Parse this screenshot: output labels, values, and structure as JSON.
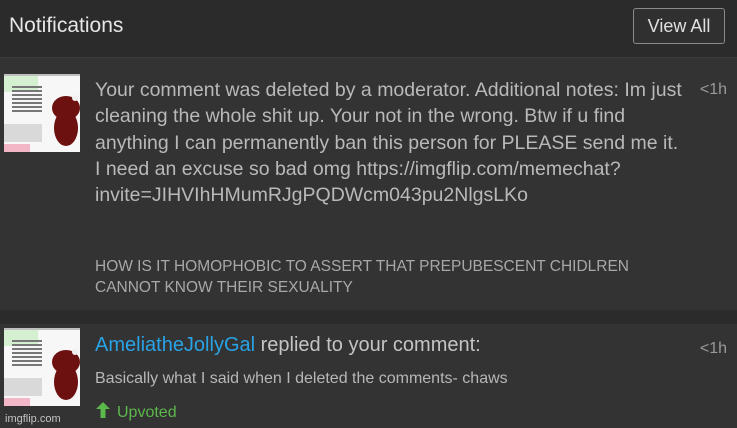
{
  "header": {
    "title": "Notifications",
    "view_all_label": "View All"
  },
  "notifications": [
    {
      "text": "Your comment was deleted by a moderator. Additional notes: Im just cleaning the whole shit up. Your not in the wrong. Btw if u find anything I can permanently ban this person for PLEASE send me it. I need an excuse so bad omg https://imgflip.com/memechat?invite=JIHVIhHMumRJgPQDWcm043pu2NlgsLKo",
      "quoted": "HOW IS IT HOMOPHOBIC TO ASSERT THAT PREPUBESCENT CHIDLREN CANNOT KNOW THEIR SEXUALITY",
      "time": "<1h"
    },
    {
      "username": "AmeliatheJollyGal",
      "action": " replied to your comment:",
      "text": "Basically what I said when I deleted the comments- chaws",
      "upvote_label": "Upvoted",
      "time": "<1h"
    }
  ],
  "watermark": "imgflip.com",
  "colors": {
    "background": "#2b2b2b",
    "card": "#333333",
    "username": "#29a3e6",
    "upvote": "#5bb84a"
  },
  "icons": {
    "upvote": "arrow-up-icon"
  }
}
